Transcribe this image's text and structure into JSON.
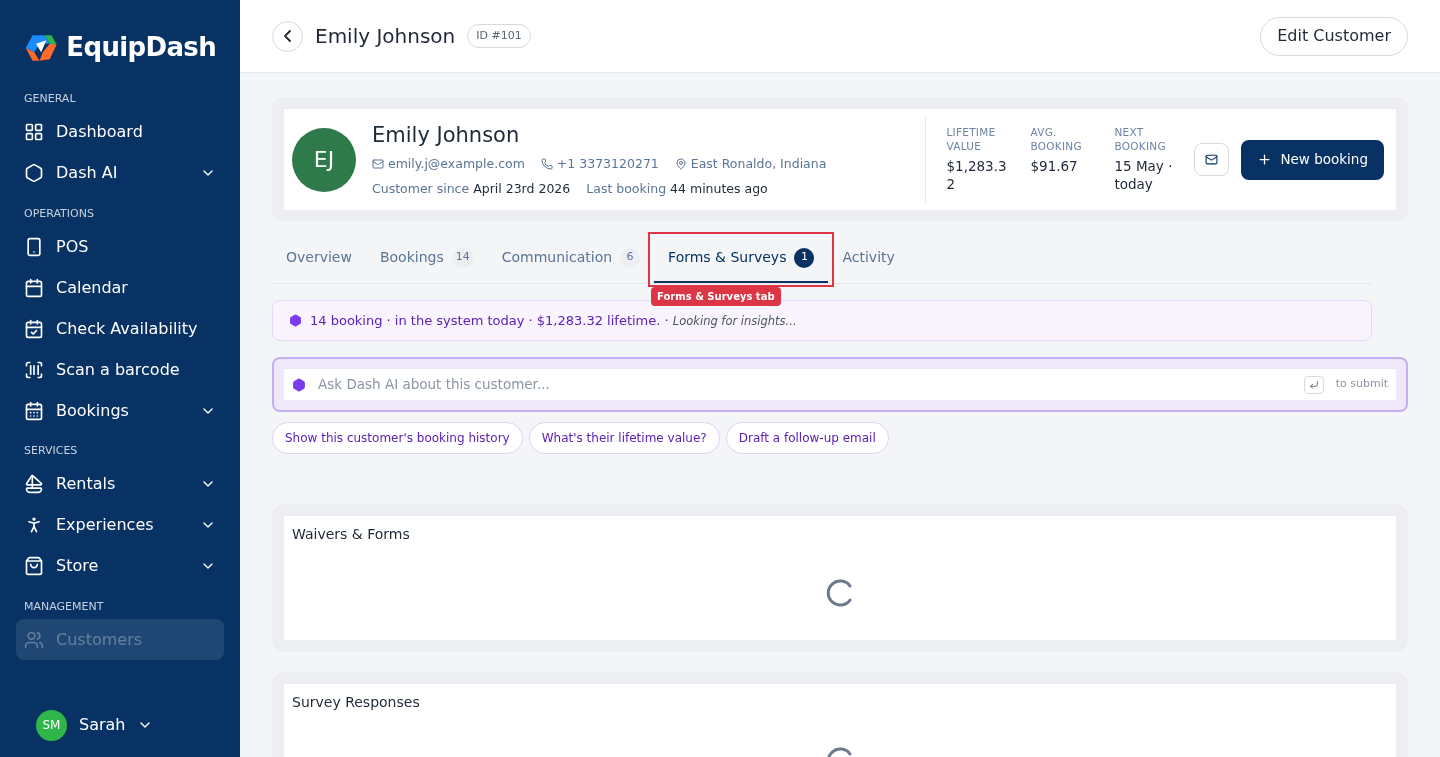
{
  "sidebar": {
    "brand": "EquipDash",
    "sections": [
      {
        "title": "GENERAL",
        "items": [
          {
            "label": "Dashboard",
            "kind": "grid",
            "expandable": false,
            "selected": false
          },
          {
            "label": "Dash AI",
            "kind": "ai",
            "expandable": true,
            "selected": false
          }
        ]
      },
      {
        "title": "OPERATIONS",
        "items": [
          {
            "label": "POS",
            "kind": "pos",
            "expandable": false,
            "selected": false
          },
          {
            "label": "Calendar",
            "kind": "calendar",
            "expandable": false,
            "selected": false
          },
          {
            "label": "Check Availability",
            "kind": "check",
            "expandable": false,
            "selected": false
          },
          {
            "label": "Scan a barcode",
            "kind": "scan",
            "expandable": false,
            "selected": false
          },
          {
            "label": "Bookings",
            "kind": "bookings",
            "expandable": true,
            "selected": false
          }
        ]
      },
      {
        "title": "SERVICES",
        "items": [
          {
            "label": "Rentals",
            "kind": "rentals",
            "expandable": true,
            "selected": false
          },
          {
            "label": "Experiences",
            "kind": "experiences",
            "expandable": true,
            "selected": false
          },
          {
            "label": "Store",
            "kind": "store",
            "expandable": true,
            "selected": false
          }
        ]
      },
      {
        "title": "MANAGEMENT",
        "items": [
          {
            "label": "Customers",
            "kind": "customers",
            "expandable": false,
            "selected": true
          }
        ]
      }
    ],
    "user": {
      "initials": "SM",
      "name": "Sarah"
    }
  },
  "header": {
    "title": "Emily Johnson",
    "id_badge": "ID #101",
    "edit_button": "Edit Customer"
  },
  "customer": {
    "initials": "EJ",
    "name": "Emily Johnson",
    "email": "emily.j@example.com",
    "phone": "+1 3373120271",
    "location": "East Ronaldo, Indiana",
    "since_label": "Customer since",
    "since_value": "April 23rd 2026",
    "last_label": "Last booking",
    "last_value": "44 minutes ago",
    "stats": [
      {
        "label": "LIFETIME VALUE",
        "value": "$1,283.32"
      },
      {
        "label": "AVG. BOOKING",
        "value": "$91.67"
      },
      {
        "label": "NEXT BOOKING",
        "value": "15 May · today"
      }
    ],
    "new_booking": "New booking"
  },
  "tabs": [
    {
      "label": "Overview",
      "selected": false
    },
    {
      "label": "Bookings",
      "count": "14",
      "selected": false
    },
    {
      "label": "Communication",
      "count": "6",
      "selected": false
    },
    {
      "label": "Forms & Surveys",
      "count": "1",
      "selected": true,
      "annotation": "Forms & Surveys tab"
    },
    {
      "label": "Activity",
      "selected": false
    }
  ],
  "insight": {
    "text": "14 booking · in the system today · $1,283.32 lifetime. · ",
    "status": "Looking for insights..."
  },
  "ask": {
    "placeholder": "Ask Dash AI about this customer...",
    "hint": "to submit"
  },
  "suggestions": [
    "Show this customer's booking history",
    "What's their lifetime value?",
    "Draft a follow-up email"
  ],
  "sections": [
    {
      "title": "Waivers & Forms",
      "loading": true
    },
    {
      "title": "Survey Responses",
      "loading": true
    }
  ]
}
